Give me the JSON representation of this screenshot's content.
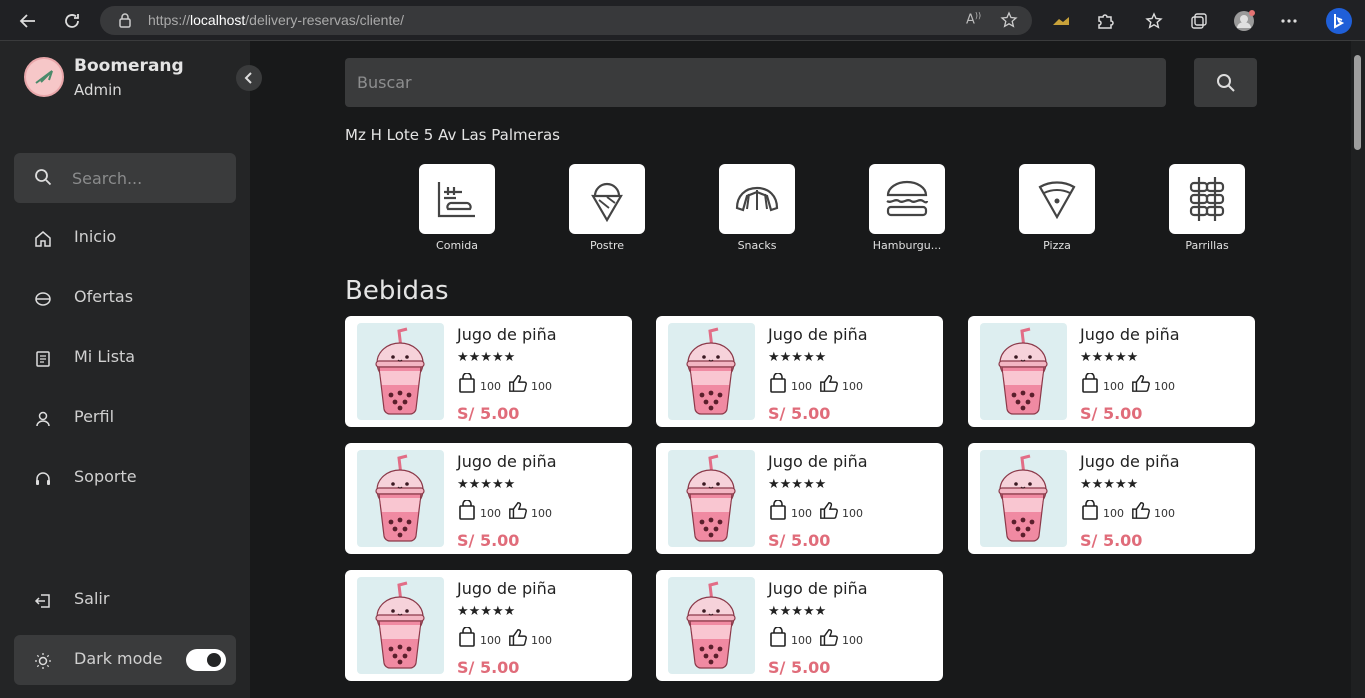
{
  "browser": {
    "url_prefix": "https://",
    "url_host": "localhost",
    "url_path": "/delivery-reservas/cliente/"
  },
  "sidebar": {
    "brand_name": "Boomerang",
    "brand_role": "Admin",
    "search_placeholder": "Search...",
    "items": [
      {
        "label": "Inicio",
        "icon": "home-icon"
      },
      {
        "label": "Ofertas",
        "icon": "ticket-icon"
      },
      {
        "label": "Mi Lista",
        "icon": "list-icon"
      },
      {
        "label": "Perfil",
        "icon": "user-icon"
      },
      {
        "label": "Soporte",
        "icon": "headset-icon"
      }
    ],
    "logout_label": "Salir",
    "dark_mode_label": "Dark mode",
    "dark_mode_on": true
  },
  "main": {
    "search_placeholder": "Buscar",
    "address": "Mz H Lote 5 Av Las Palmeras",
    "categories": [
      {
        "label": "Comida",
        "icon": "food-icon"
      },
      {
        "label": "Postre",
        "icon": "ice-cream-icon"
      },
      {
        "label": "Snacks",
        "icon": "croissant-icon"
      },
      {
        "label": "Hamburgu...",
        "icon": "burger-icon"
      },
      {
        "label": "Pizza",
        "icon": "pizza-icon"
      },
      {
        "label": "Parrillas",
        "icon": "skewer-icon"
      }
    ],
    "section_title": "Bebidas",
    "products": [
      {
        "name": "Jugo de piña",
        "stars": "★★★★★",
        "orders": "100",
        "likes": "100",
        "price": "S/ 5.00"
      },
      {
        "name": "Jugo de piña",
        "stars": "★★★★★",
        "orders": "100",
        "likes": "100",
        "price": "S/ 5.00"
      },
      {
        "name": "Jugo de piña",
        "stars": "★★★★★",
        "orders": "100",
        "likes": "100",
        "price": "S/ 5.00"
      },
      {
        "name": "Jugo de piña",
        "stars": "★★★★★",
        "orders": "100",
        "likes": "100",
        "price": "S/ 5.00"
      },
      {
        "name": "Jugo de piña",
        "stars": "★★★★★",
        "orders": "100",
        "likes": "100",
        "price": "S/ 5.00"
      },
      {
        "name": "Jugo de piña",
        "stars": "★★★★★",
        "orders": "100",
        "likes": "100",
        "price": "S/ 5.00"
      },
      {
        "name": "Jugo de piña",
        "stars": "★★★★★",
        "orders": "100",
        "likes": "100",
        "price": "S/ 5.00"
      },
      {
        "name": "Jugo de piña",
        "stars": "★★★★★",
        "orders": "100",
        "likes": "100",
        "price": "S/ 5.00"
      }
    ]
  },
  "colors": {
    "background": "#18191a",
    "sidebar": "#242526",
    "input": "#3a3b3c",
    "price": "#e06c7a"
  }
}
